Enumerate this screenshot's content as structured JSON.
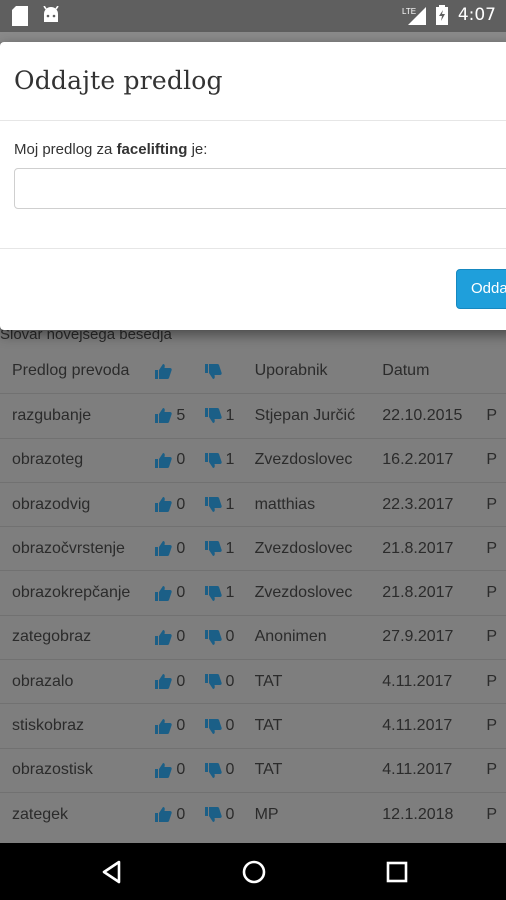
{
  "status_bar": {
    "time": "4:07",
    "network": "LTE"
  },
  "page": {
    "caption": "Slovar novejšega besedja",
    "columns": [
      "Predlog prevoda",
      "",
      "",
      "Uporabnik",
      "Datum",
      ""
    ],
    "rows": [
      {
        "term": "razgubanje",
        "up": "5",
        "down": "1",
        "user": "Stjepan Jurčić",
        "date": "22.10.2015",
        "extra": "P"
      },
      {
        "term": "obrazoteg",
        "up": "0",
        "down": "1",
        "user": "Zvezdoslovec",
        "date": "16.2.2017",
        "extra": "P"
      },
      {
        "term": "obrazodvig",
        "up": "0",
        "down": "1",
        "user": "matthias",
        "date": "22.3.2017",
        "extra": "P"
      },
      {
        "term": "obrazočvrstenje",
        "up": "0",
        "down": "1",
        "user": "Zvezdoslovec",
        "date": "21.8.2017",
        "extra": "P"
      },
      {
        "term": "obrazokrepčanje",
        "up": "0",
        "down": "1",
        "user": "Zvezdoslovec",
        "date": "21.8.2017",
        "extra": "P"
      },
      {
        "term": "zategobraz",
        "up": "0",
        "down": "0",
        "user": "Anonimen",
        "date": "27.9.2017",
        "extra": "P"
      },
      {
        "term": "obrazalo",
        "up": "0",
        "down": "0",
        "user": "TAT",
        "date": "4.11.2017",
        "extra": "P"
      },
      {
        "term": "stiskobraz",
        "up": "0",
        "down": "0",
        "user": "TAT",
        "date": "4.11.2017",
        "extra": "P"
      },
      {
        "term": "obrazostisk",
        "up": "0",
        "down": "0",
        "user": "TAT",
        "date": "4.11.2017",
        "extra": "P"
      },
      {
        "term": "zategek",
        "up": "0",
        "down": "0",
        "user": "MP",
        "date": "12.1.2018",
        "extra": "P"
      }
    ]
  },
  "dialog": {
    "title": "Oddajte predlog",
    "label_prefix": "Moj predlog za ",
    "label_term": "facelifting",
    "label_suffix": " je:",
    "input_value": "",
    "submit_label": "Oddaj"
  },
  "colors": {
    "accent": "#1f9fdb",
    "thumb": "#1b5f87"
  },
  "icons": [
    "sd-card-icon",
    "android-icon",
    "lte-signal-icon",
    "battery-charging-icon",
    "thumbs-up-icon",
    "thumbs-down-icon",
    "back-icon",
    "home-icon",
    "recents-icon"
  ]
}
